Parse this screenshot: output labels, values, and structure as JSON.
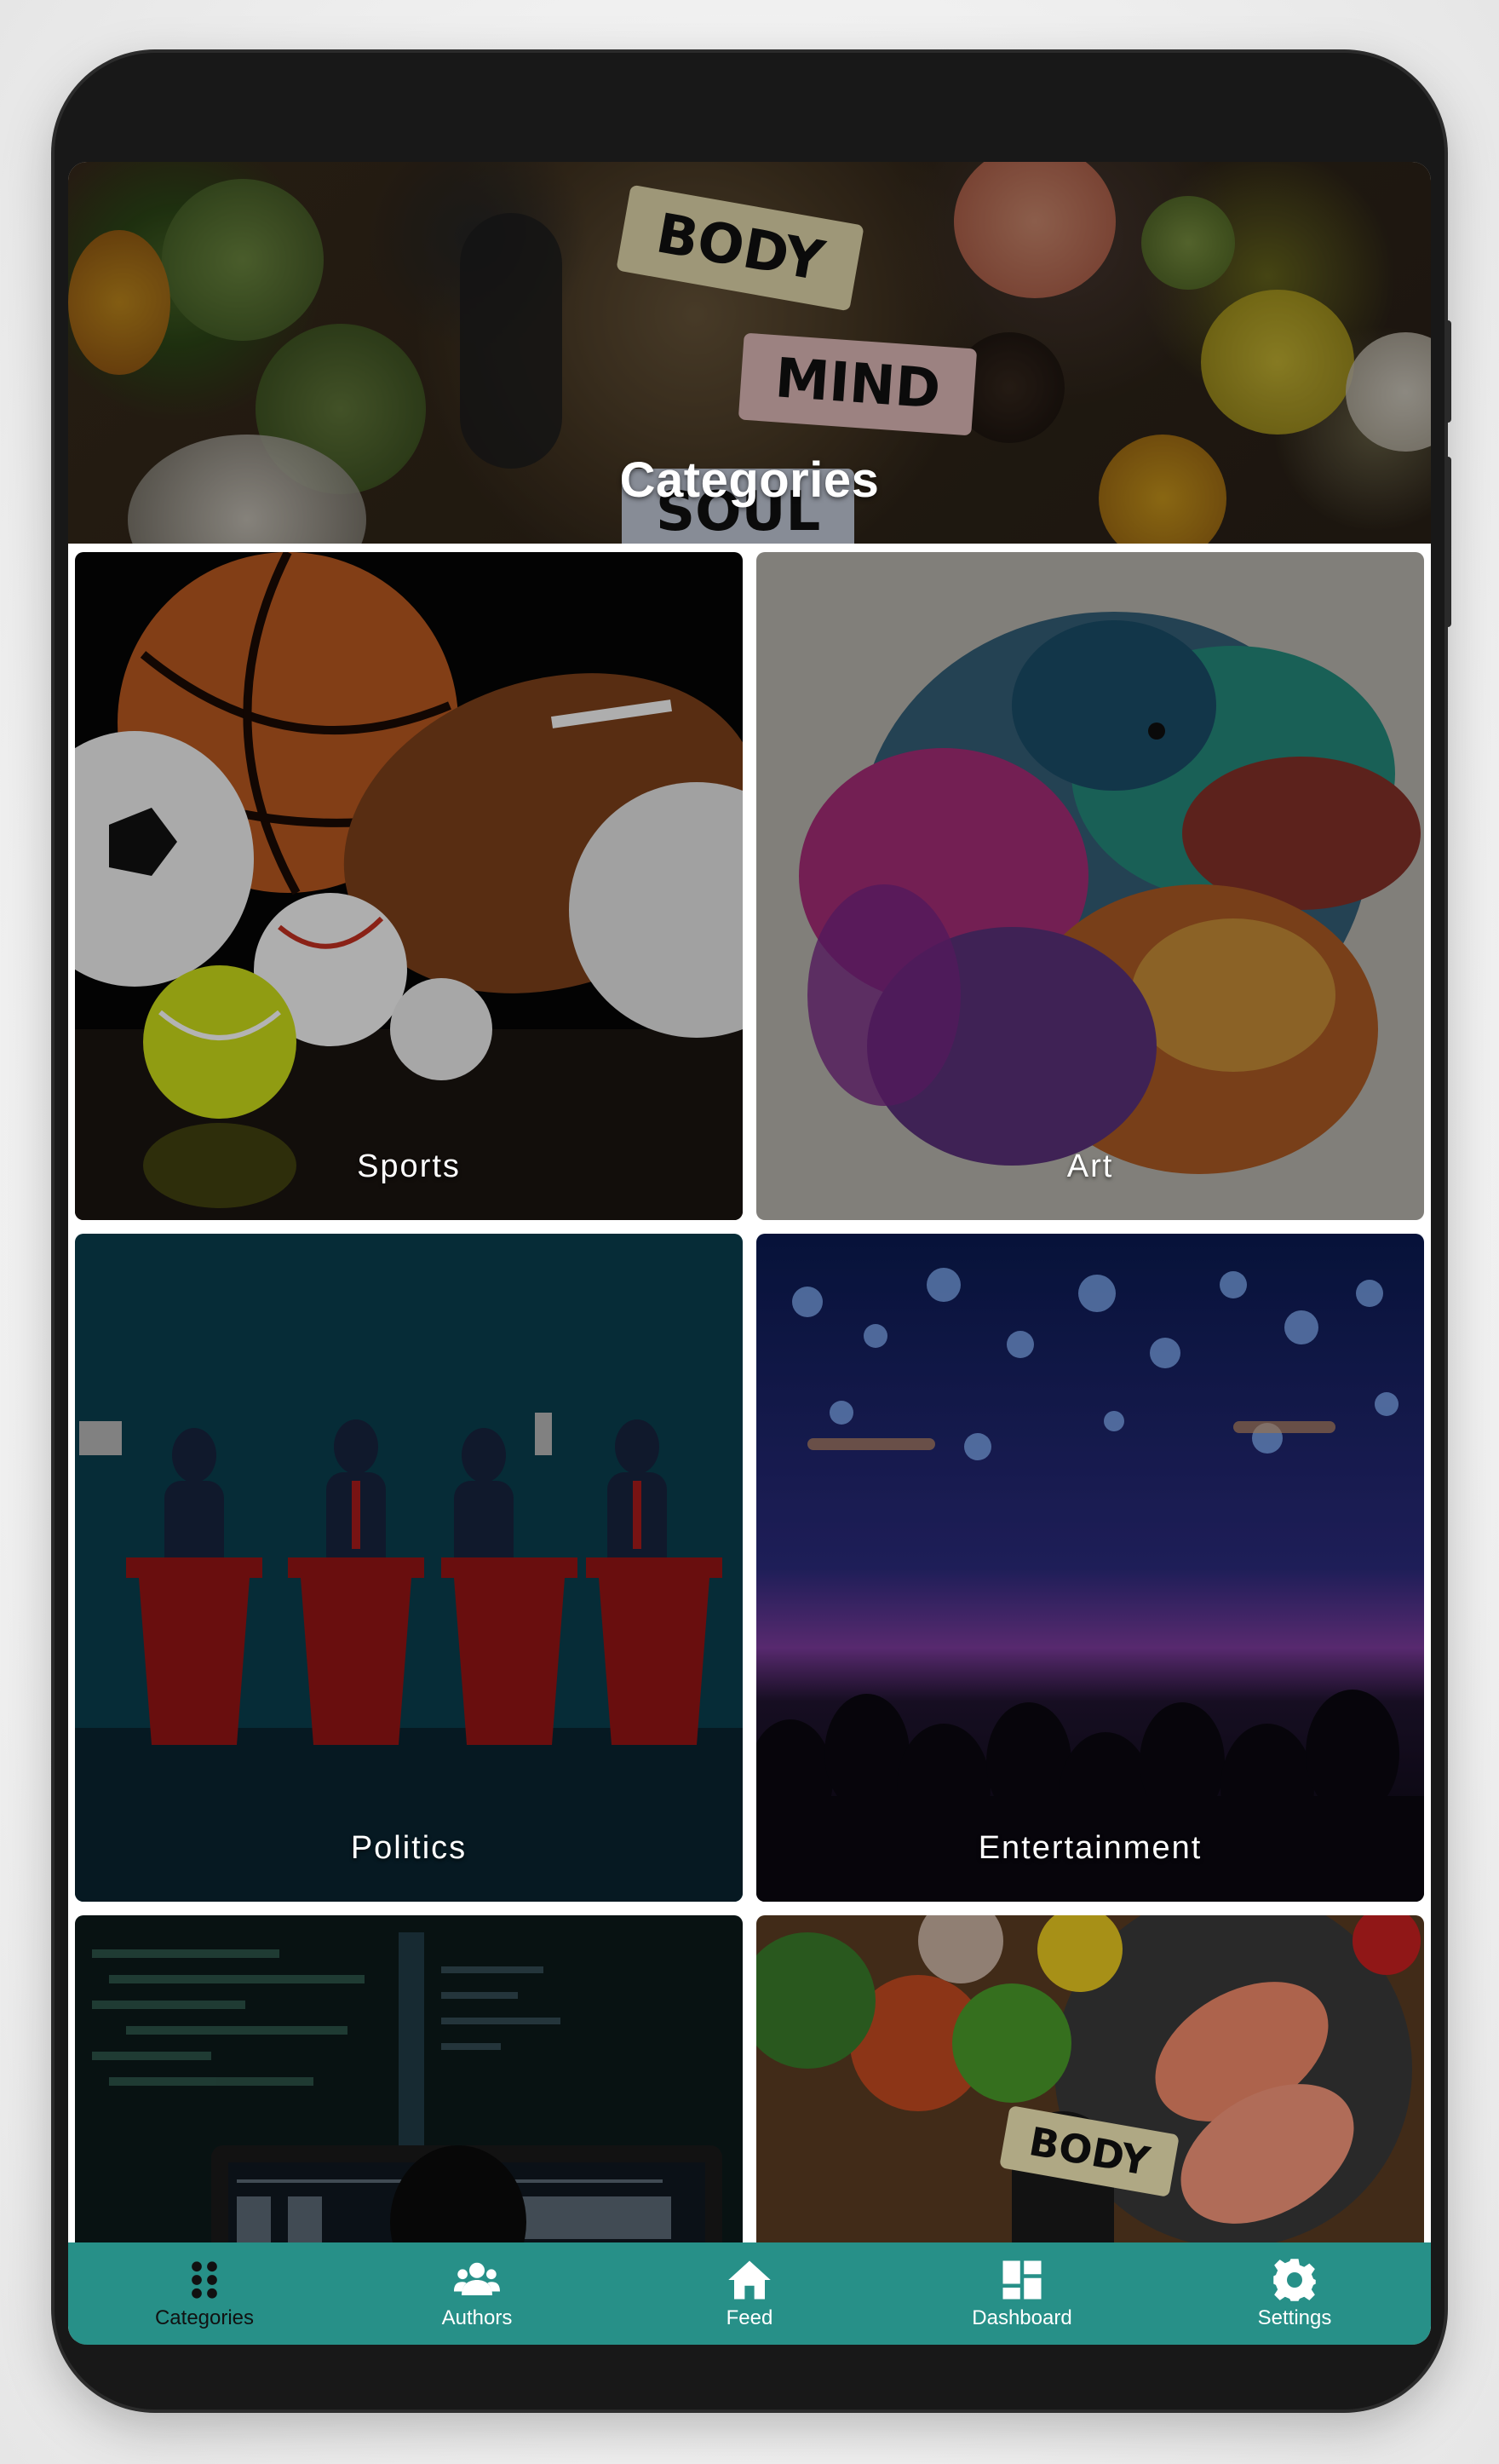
{
  "header": {
    "title": "Categories",
    "signs": [
      "BODY",
      "MIND",
      "SOUL"
    ]
  },
  "categories": [
    {
      "label": "Sports"
    },
    {
      "label": "Art"
    },
    {
      "label": "Politics"
    },
    {
      "label": "Entertainment"
    },
    {
      "label": ""
    },
    {
      "label": ""
    }
  ],
  "food_tile_sign": "BODY",
  "bottom_nav": {
    "active": "Categories",
    "items": [
      {
        "label": "Categories",
        "icon": "grid-icon"
      },
      {
        "label": "Authors",
        "icon": "users-icon"
      },
      {
        "label": "Feed",
        "icon": "home-icon"
      },
      {
        "label": "Dashboard",
        "icon": "dashboard-icon"
      },
      {
        "label": "Settings",
        "icon": "gear-icon"
      }
    ]
  },
  "colors": {
    "nav_background": "#279088",
    "nav_active": "#111111",
    "nav_inactive": "#ffffff",
    "device_frame": "#181818"
  }
}
